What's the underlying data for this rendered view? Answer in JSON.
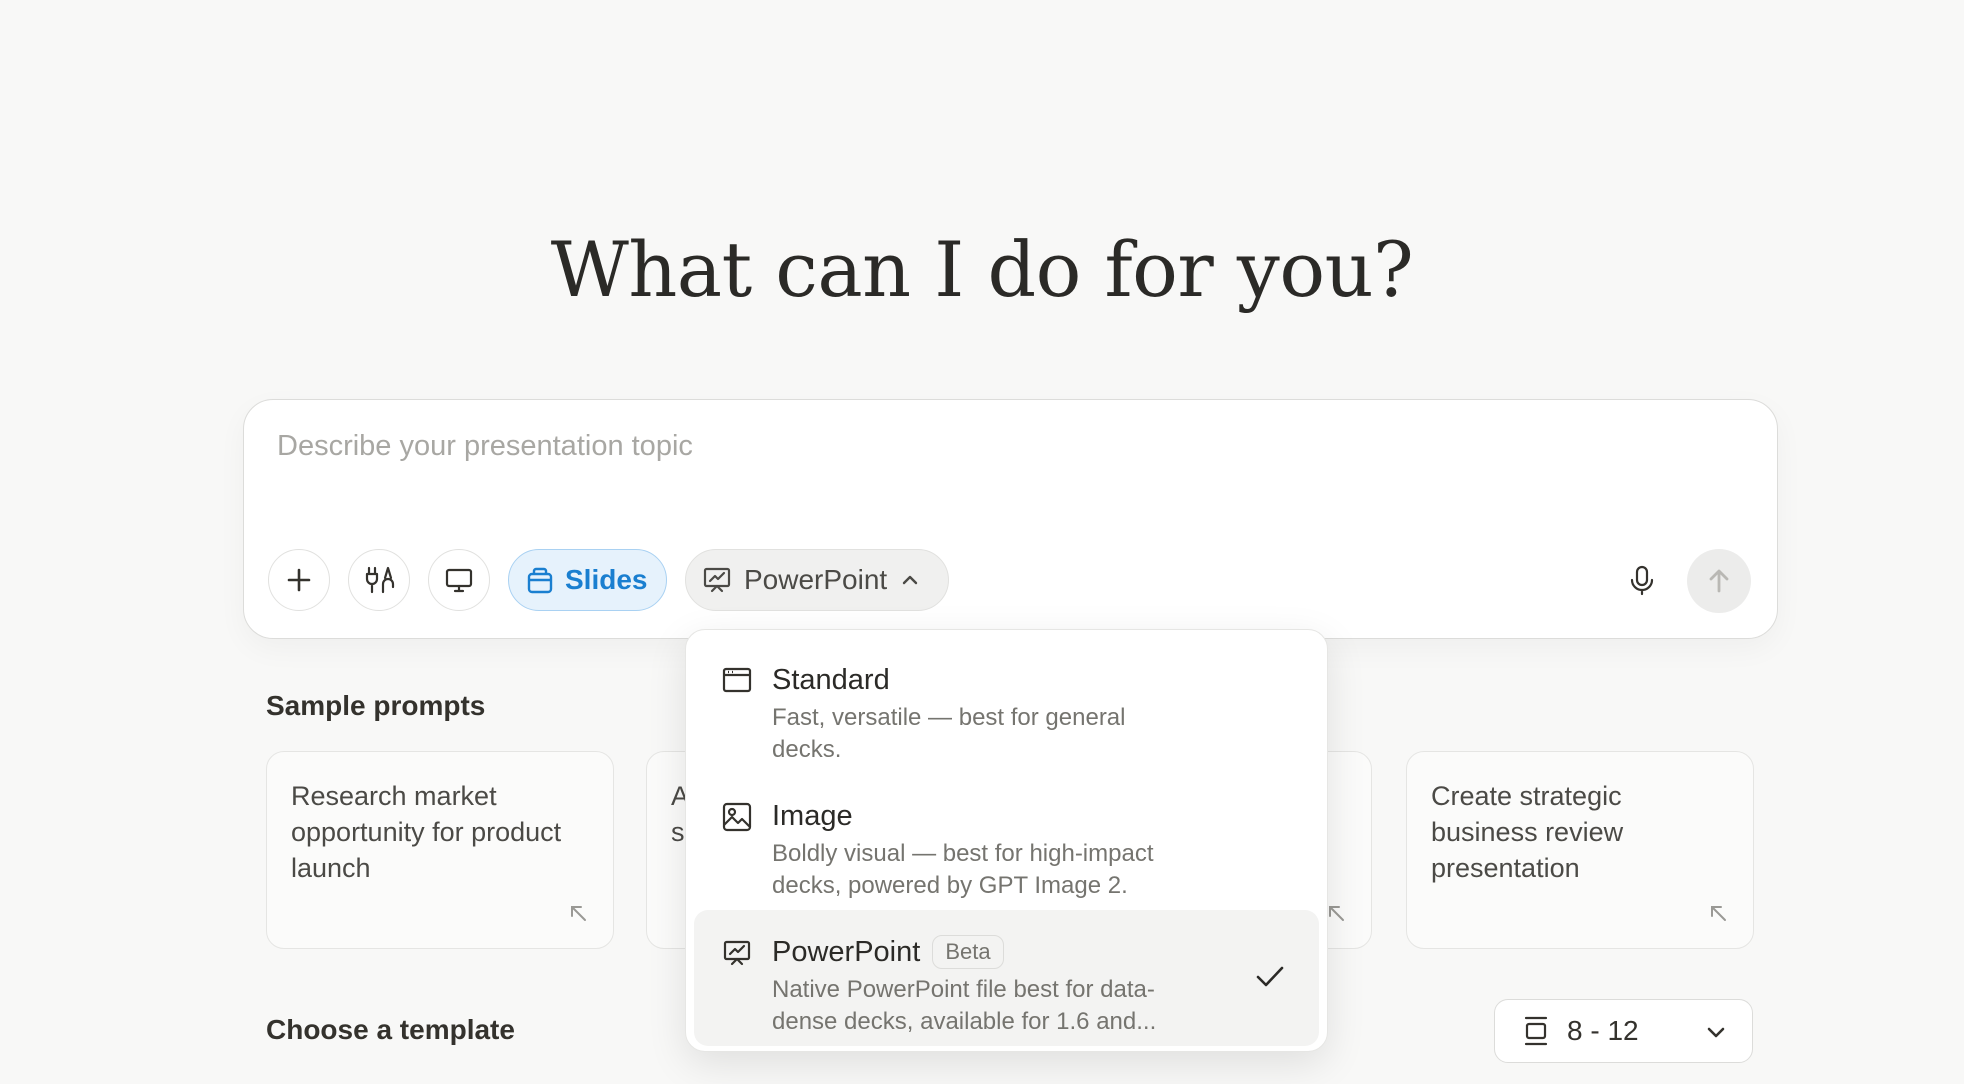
{
  "headline": "What can I do for you?",
  "composer": {
    "placeholder": "Describe your presentation topic",
    "slides_label": "Slides",
    "format_label": "PowerPoint"
  },
  "sample_prompts": {
    "title": "Sample prompts",
    "cards": [
      {
        "text": "Research market opportunity for product launch"
      },
      {
        "text": "A s"
      },
      {
        "text": ""
      },
      {
        "text": "Create strategic business review presentation"
      }
    ]
  },
  "template": {
    "title": "Choose a template",
    "slide_count": "8 - 12"
  },
  "dropdown": {
    "options": [
      {
        "title": "Standard",
        "desc": "Fast, versatile — best for general decks.",
        "icon": "window-icon"
      },
      {
        "title": "Image",
        "desc": "Boldly visual — best for high-impact decks, powered by GPT Image 2.",
        "icon": "image-icon"
      },
      {
        "title": "PowerPoint",
        "badge": "Beta",
        "desc": "Native PowerPoint file best for data-dense decks, available for 1.6 and...",
        "icon": "presentation-icon",
        "selected": true
      }
    ]
  },
  "colors": {
    "accent": "#1a7fd0",
    "accent_bg": "#e6f2fc",
    "background": "#f8f8f7"
  }
}
